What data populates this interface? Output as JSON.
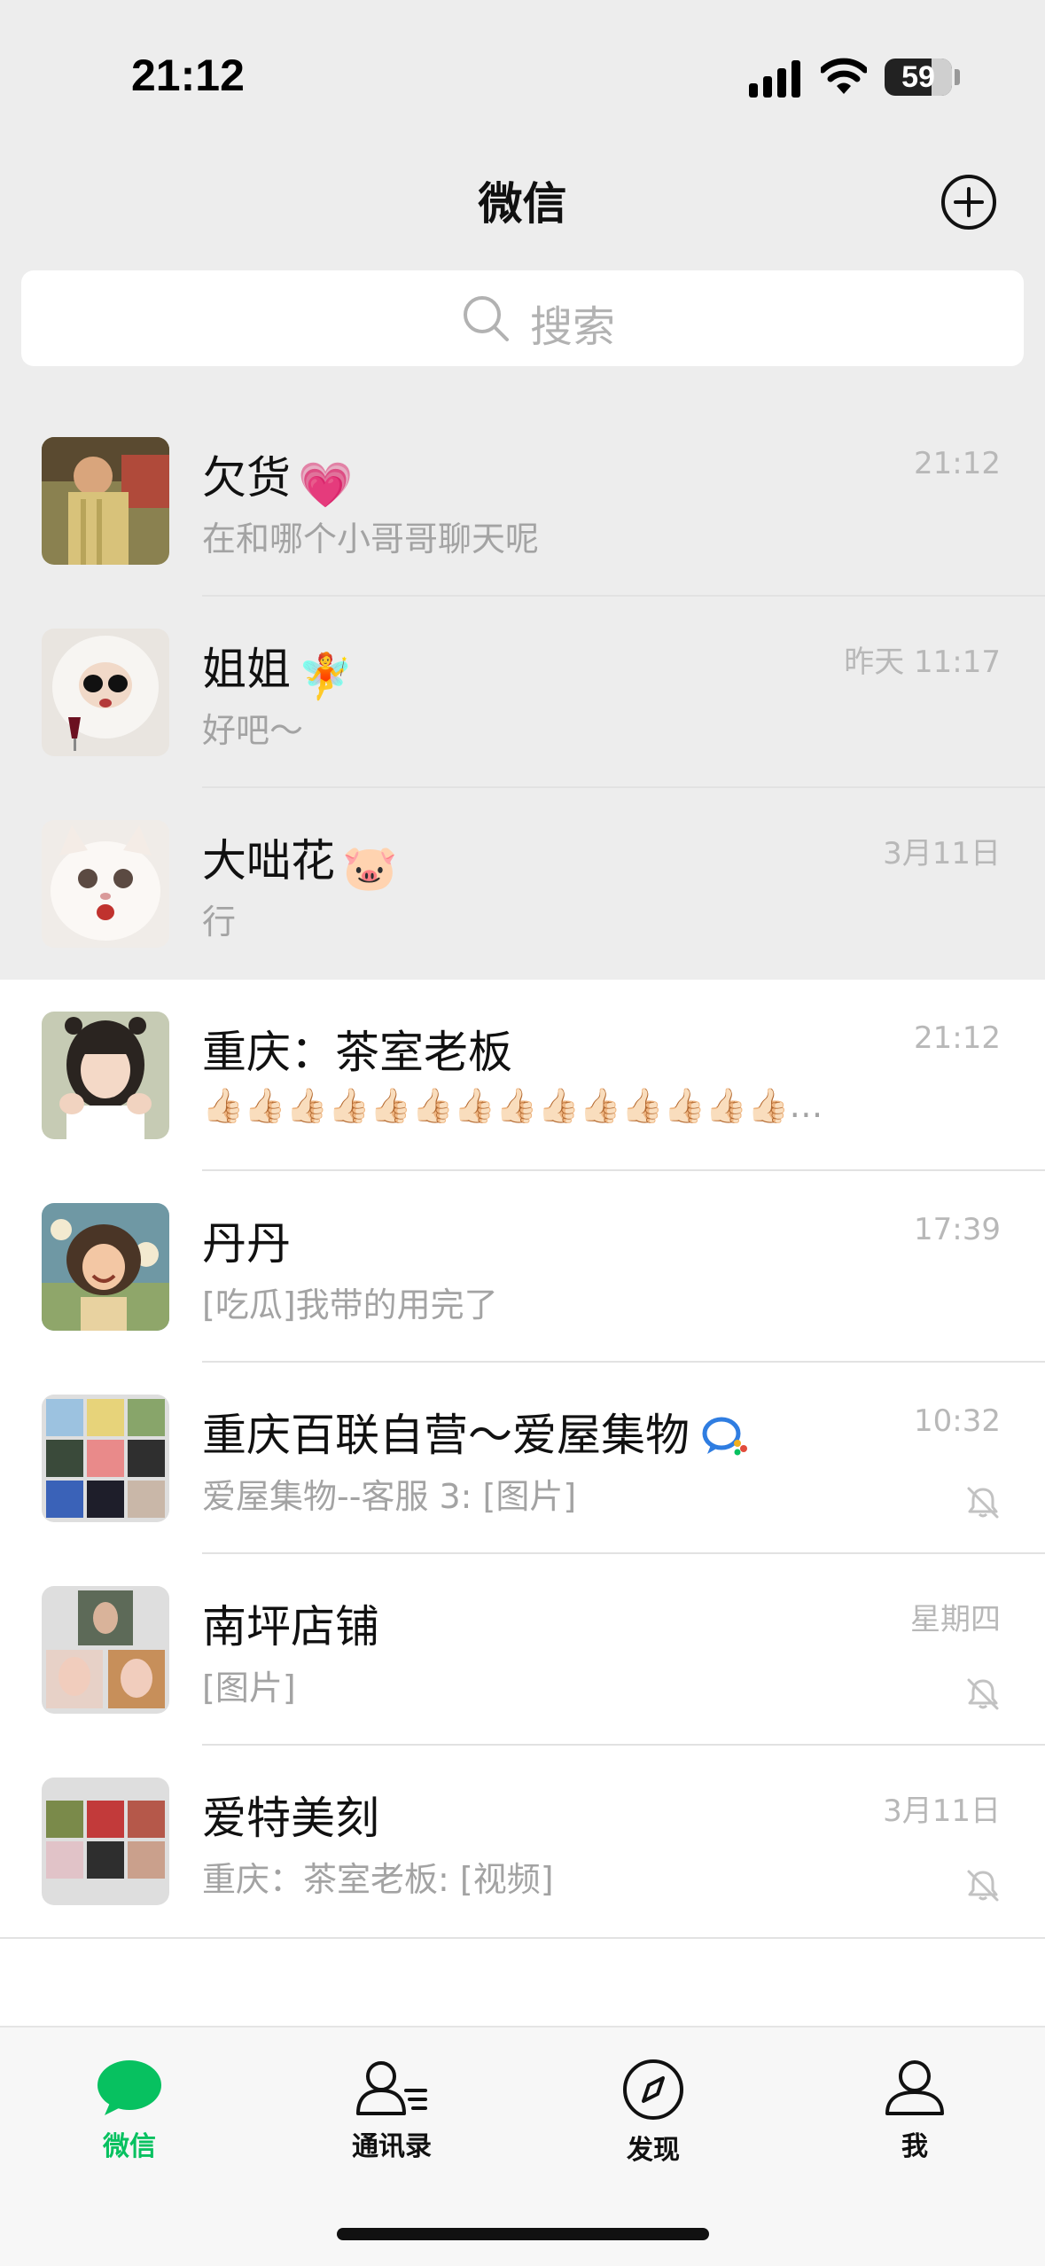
{
  "status_bar": {
    "time": "21:12",
    "battery": "59"
  },
  "header": {
    "title": "微信"
  },
  "search": {
    "placeholder": "搜索"
  },
  "chats": [
    {
      "name": "欠货",
      "emoji": "💗",
      "preview": "在和哪个小哥哥聊天呢",
      "time": "21:12",
      "pinned": true,
      "muted": false
    },
    {
      "name": "姐姐",
      "emoji": "🧚",
      "preview": "好吧～",
      "time": "昨天 11:17",
      "pinned": true,
      "muted": false
    },
    {
      "name": "大咄花",
      "emoji": "🐷",
      "preview": "行",
      "time": "3月11日",
      "pinned": true,
      "muted": false
    },
    {
      "name": "重庆：茶室老板",
      "emoji": "",
      "preview": "👍🏻👍🏻👍🏻👍🏻👍🏻👍🏻👍🏻👍🏻👍🏻👍🏻👍🏻👍🏻👍🏻👍🏻…",
      "time": "21:12",
      "pinned": false,
      "muted": false
    },
    {
      "name": "丹丹",
      "emoji": "",
      "preview": "[吃瓜]我带的用完了",
      "time": "17:39",
      "pinned": false,
      "muted": false
    },
    {
      "name": "重庆百联自营～爱屋集物",
      "emoji": "",
      "preview": "爱屋集物--客服 3: [图片]",
      "time": "10:32",
      "pinned": false,
      "muted": true
    },
    {
      "name": "南坪店铺",
      "emoji": "",
      "preview": "[图片]",
      "time": "星期四",
      "pinned": false,
      "muted": true
    },
    {
      "name": "爱特美刻",
      "emoji": "",
      "preview": "重庆：茶室老板: [视频]",
      "time": "3月11日",
      "pinned": false,
      "muted": true
    }
  ],
  "tabs": [
    {
      "label": "微信",
      "icon": "chat-bubble-icon",
      "active": true
    },
    {
      "label": "通讯录",
      "icon": "contacts-icon",
      "active": false
    },
    {
      "label": "发现",
      "icon": "compass-icon",
      "active": false
    },
    {
      "label": "我",
      "icon": "person-icon",
      "active": false
    }
  ],
  "colors": {
    "accent": "#07c160",
    "pinned_bg": "#ededed",
    "muted_text": "#a3a3a3"
  }
}
